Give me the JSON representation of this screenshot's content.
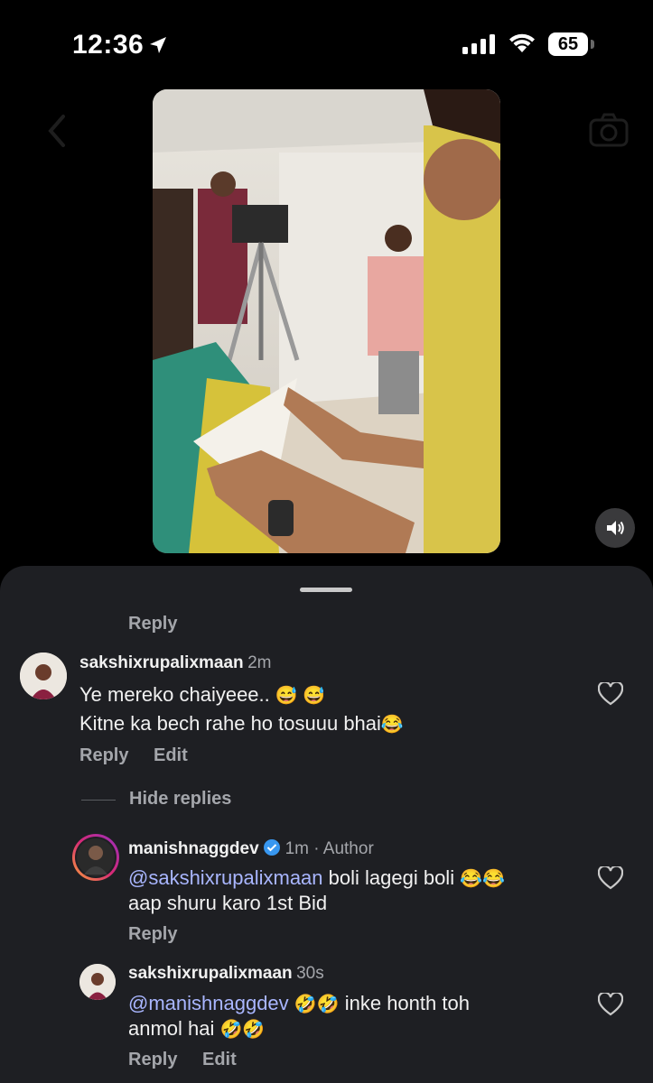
{
  "status_bar": {
    "time": "12:36",
    "battery": "65"
  },
  "comments": {
    "top_reply_label": "Reply",
    "comment1": {
      "username": "sakshixrupalixmaan",
      "time": "2m",
      "line1_text": "Ye mereko chaiyeee..",
      "line1_emoji": "😅 😅",
      "line2_text": "Kitne ka bech rahe ho tosuuu bhai",
      "line2_emoji": "😂",
      "reply_label": "Reply",
      "edit_label": "Edit"
    },
    "hide_replies_label": "Hide replies",
    "reply1": {
      "username": "manishnaggdev",
      "time": "1m · Author",
      "mention": "@sakshixrupalixmaan",
      "line1_text": " boli lagegi boli ",
      "line1_emoji": "😂😂",
      "line2_text": "aap shuru karo 1st Bid",
      "reply_label": "Reply"
    },
    "reply2": {
      "username": "sakshixrupalixmaan",
      "time": "30s",
      "mention": "@manishnaggdev",
      "line1_emoji": "🤣🤣",
      "line1_text": " inke honth toh",
      "line2_text": "anmol hai ",
      "line2_emoji": "🤣🤣",
      "reply_label": "Reply",
      "edit_label": "Edit"
    }
  },
  "colors": {
    "sheet_bg": "#1e1f23",
    "mention": "#a9b6ff",
    "muted": "#a4a6ab",
    "verified": "#3897f0"
  },
  "icons": [
    "location-arrow-icon",
    "cellular-signal-icon",
    "wifi-icon",
    "battery-icon",
    "back-chevron-icon",
    "camera-icon",
    "speaker-icon",
    "heart-icon",
    "verified-badge-icon"
  ]
}
